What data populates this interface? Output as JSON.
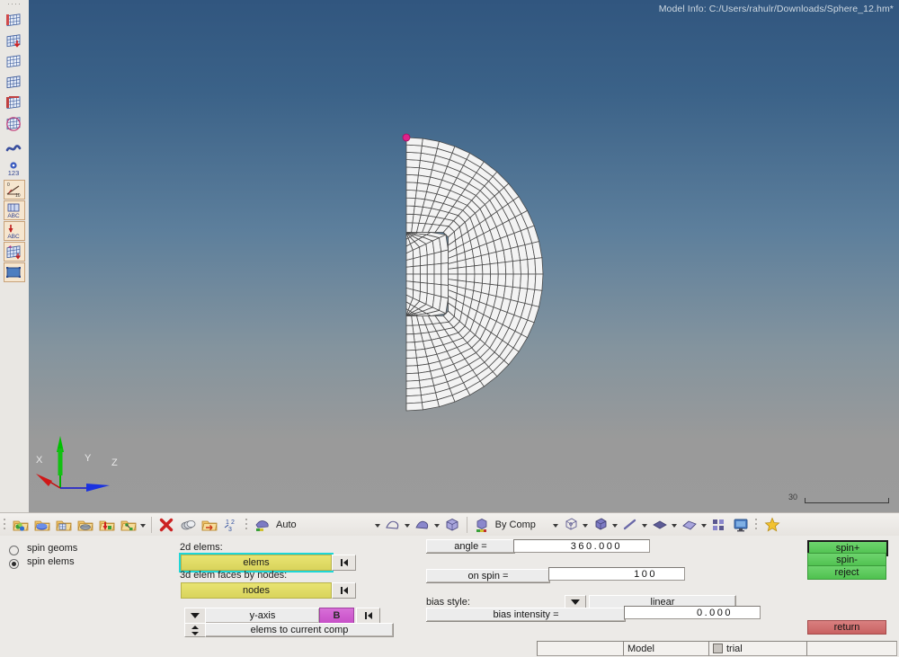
{
  "viewport": {
    "model_info": "Model Info: C:/Users/rahulr/Downloads/Sphere_12.hm*",
    "scale_value": "30",
    "triad": {
      "x_label": "X",
      "y_label": "Y",
      "z_label": "Z"
    },
    "background_top_color": "#31567f",
    "background_bottom_color": "#9a9a9a",
    "mesh_face_color": "#f3f3f3",
    "mesh_line_color": "#4a4a4a",
    "node_marker_color": "#e0218a"
  },
  "left_toolbar": {
    "items": [
      {
        "name": "model-browser-icon",
        "label": "Model Browser"
      },
      {
        "name": "import-solver-deck-icon",
        "label": "Import"
      },
      {
        "name": "solver-browser-icon",
        "label": "Solver Browser"
      },
      {
        "name": "part-browser-icon",
        "label": "Part Browser"
      },
      {
        "name": "entity-state-browser-icon",
        "label": "Entity State Browser"
      },
      {
        "name": "mask-browser-icon",
        "label": "Mask Browser"
      },
      {
        "name": "info-icon",
        "label": "Entity Info"
      },
      {
        "name": "count-123-icon",
        "label": "Count"
      },
      {
        "name": "measure-icon",
        "label": "Measure"
      },
      {
        "name": "text-annotation-icon",
        "label": "Text Annotation"
      },
      {
        "name": "dimension-icon",
        "label": "Dimensioning"
      },
      {
        "name": "node-edit-icon",
        "label": "Node Edit"
      },
      {
        "name": "image-capture-icon",
        "label": "Capture Graphics Area"
      }
    ]
  },
  "toolbar": {
    "groups": [
      {
        "buttons": [
          {
            "name": "geometry-icon",
            "label": "Geometry"
          },
          {
            "name": "surfaces-icon",
            "label": "Surfaces"
          },
          {
            "name": "solid-map-icon",
            "label": "Solid Map"
          },
          {
            "name": "mesh-icon",
            "label": "2D Mesh"
          },
          {
            "name": "node-create-icon",
            "label": "Nodes"
          },
          {
            "name": "connector-icon",
            "label": "Connectors",
            "has_arrow": true
          }
        ]
      },
      {
        "buttons": [
          {
            "name": "delete-icon",
            "label": "Delete"
          },
          {
            "name": "organize-icon",
            "label": "Organize"
          },
          {
            "name": "reflect-icon",
            "label": "Reflect"
          },
          {
            "name": "renumber-icon",
            "label": "Renumber"
          }
        ]
      }
    ],
    "auto_label": "Auto",
    "auto_icon": "auto-display-icon",
    "by_comp_label": "By Comp",
    "by_comp_icon": "by-comp-color-icon",
    "shade_buttons": [
      {
        "name": "wireframe-geometry-icon"
      },
      {
        "name": "shaded-geometry-icon"
      },
      {
        "name": "shaded-solid-icon"
      }
    ],
    "view_buttons": [
      {
        "name": "wireframe-cube-icon"
      },
      {
        "name": "shaded-cube-icon"
      },
      {
        "name": "line-element-icon"
      },
      {
        "name": "shell-element-icon"
      },
      {
        "name": "plate-element-icon"
      },
      {
        "name": "mesh-layout-icon"
      },
      {
        "name": "display-monitor-icon"
      }
    ],
    "favorite_icon": "star-favorite-icon"
  },
  "panel": {
    "mode": {
      "options": [
        {
          "label": "spin geoms",
          "selected": false
        },
        {
          "label": "spin elems",
          "selected": true
        }
      ]
    },
    "selectors": [
      {
        "caption": "2d elems:",
        "value": "elems",
        "active": true
      },
      {
        "caption": "3d elem faces by nodes:",
        "value": "nodes",
        "active": false
      }
    ],
    "axis_row": {
      "value": "y-axis",
      "base_label": "B"
    },
    "dest_row": {
      "value": "elems to current comp"
    },
    "fields": [
      {
        "label": "angle =",
        "value": "360.000"
      },
      {
        "label": "on spin =",
        "value": "100"
      }
    ],
    "bias_style": {
      "caption": "bias style:",
      "value": "linear"
    },
    "bias_intensity": {
      "label": "bias intensity =",
      "value": "0.000"
    },
    "action_buttons": [
      {
        "label": "spin+",
        "color": "#5bc85b",
        "focused": true
      },
      {
        "label": "spin-",
        "color": "#5bc85b",
        "focused": false
      },
      {
        "label": "reject",
        "color": "#5bc85b",
        "focused": false
      }
    ],
    "return_button": {
      "label": "return",
      "color": "#c96262"
    }
  },
  "status_bar": {
    "cells": [
      {
        "label": ""
      },
      {
        "label": "Model"
      },
      {
        "label": "trial",
        "has_checkbox": true
      },
      {
        "label": ""
      }
    ]
  }
}
